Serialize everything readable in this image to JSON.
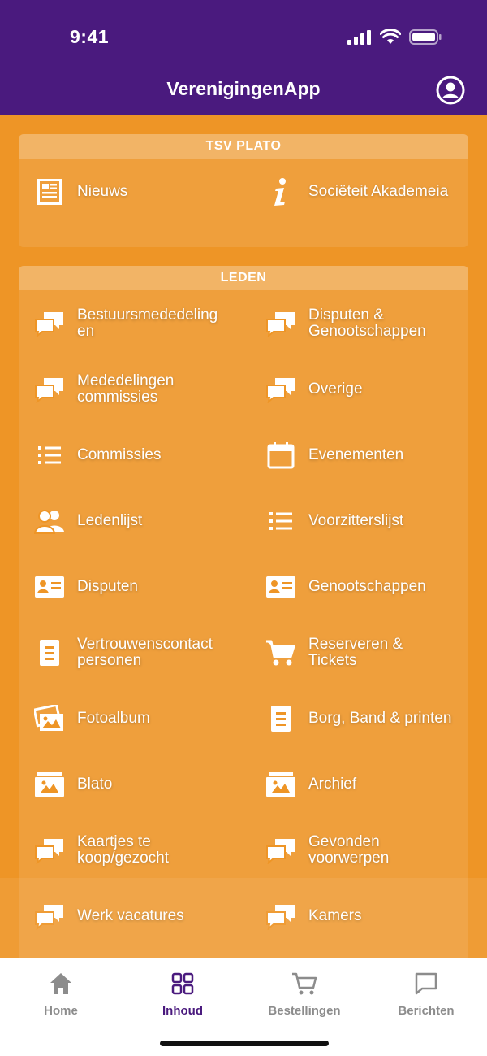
{
  "status_bar": {
    "time": "9:41"
  },
  "header": {
    "title": "VerenigingenApp",
    "account_icon": "user-circle-icon"
  },
  "sections": [
    {
      "title": "TSV PLATO",
      "items": [
        {
          "label": "Nieuws",
          "icon": "newspaper-icon"
        },
        {
          "label": "Sociëteit Akademeia",
          "icon": "info-icon"
        }
      ]
    },
    {
      "title": "LEDEN",
      "items": [
        {
          "label": "Bestuursmededeling\nen",
          "icon": "chat-bubbles-icon"
        },
        {
          "label": "Disputen &\nGenootschappen",
          "icon": "chat-bubbles-icon"
        },
        {
          "label": "Mededelingen\ncommissies",
          "icon": "chat-bubbles-icon"
        },
        {
          "label": "Overige",
          "icon": "chat-bubbles-icon"
        },
        {
          "label": "Commissies",
          "icon": "list-icon"
        },
        {
          "label": "Evenementen",
          "icon": "calendar-icon"
        },
        {
          "label": "Ledenlijst",
          "icon": "users-icon"
        },
        {
          "label": "Voorzitterslijst",
          "icon": "list-icon"
        },
        {
          "label": "Disputen",
          "icon": "id-card-icon"
        },
        {
          "label": "Genootschappen",
          "icon": "id-card-icon"
        },
        {
          "label": "Vertrouwenscontact\npersonen",
          "icon": "document-icon"
        },
        {
          "label": "Reserveren &\nTickets",
          "icon": "cart-icon"
        },
        {
          "label": "Fotoalbum",
          "icon": "photos-icon"
        },
        {
          "label": "Borg, Band & printen",
          "icon": "document-icon"
        },
        {
          "label": "Blato",
          "icon": "archive-icon"
        },
        {
          "label": "Archief",
          "icon": "archive-icon"
        },
        {
          "label": "Kaartjes te\nkoop/gezocht",
          "icon": "chat-bubbles-icon"
        },
        {
          "label": "Gevonden\nvoorwerpen",
          "icon": "chat-bubbles-icon"
        },
        {
          "label": "Werk vacatures",
          "icon": "chat-bubbles-icon"
        },
        {
          "label": "Kamers",
          "icon": "chat-bubbles-icon"
        }
      ]
    }
  ],
  "tabbar": {
    "tabs": [
      {
        "label": "Home",
        "icon": "home-icon",
        "active": false
      },
      {
        "label": "Inhoud",
        "icon": "grid-icon",
        "active": true
      },
      {
        "label": "Bestellingen",
        "icon": "cart-outline-icon",
        "active": false
      },
      {
        "label": "Berichten",
        "icon": "message-icon",
        "active": false
      }
    ]
  },
  "colors": {
    "header": "#4a1a7e",
    "background": "#ee9526",
    "active_tab": "#4a1a7e"
  }
}
